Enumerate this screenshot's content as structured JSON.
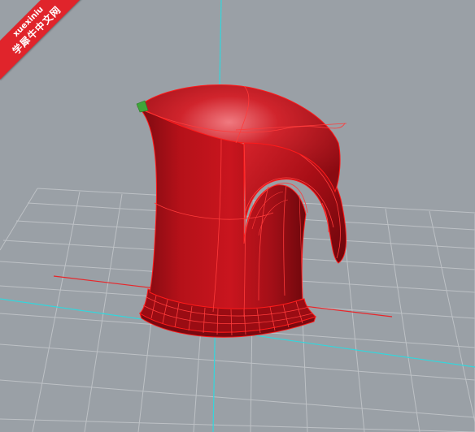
{
  "viewport": {
    "background": "#9aa0a6",
    "grid_color": "#c9ccd0",
    "x_axis_color": "#e8262a",
    "y_axis_color": "#33d6dc",
    "model_color": "#c1121b",
    "edge_color": "#ff1a1a"
  },
  "watermark": {
    "line1": "xuexiniu",
    "line2": "学犀牛中文网",
    "color": "#e0242b"
  }
}
